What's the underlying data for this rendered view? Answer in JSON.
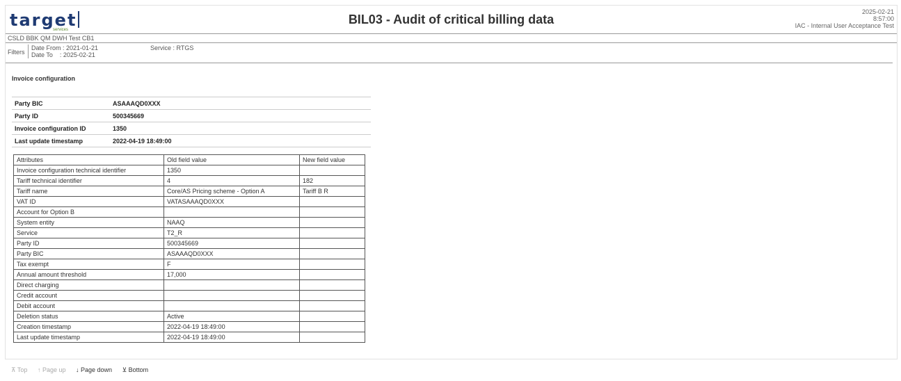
{
  "header": {
    "logo_text": "target",
    "logo_sub": "services",
    "title": "BIL03 - Audit of critical billing data",
    "date": "2025-02-21",
    "time": "8:57:00",
    "environment_name": "IAC - Internal User Acceptance Test"
  },
  "env_line": "CSLD BBK QM DWH Test CB1",
  "filters": {
    "label": "Filters",
    "date_from": "Date From : 2021-01-21",
    "date_to": "Date To    : 2025-02-21",
    "service": "Service : RTGS"
  },
  "section_title": "Invoice configuration",
  "summary": [
    {
      "key": "Party BIC",
      "value": "ASAAAQD0XXX"
    },
    {
      "key": "Party ID",
      "value": "500345669"
    },
    {
      "key": "Invoice configuration ID",
      "value": "1350"
    },
    {
      "key": "Last update timestamp",
      "value": "2022-04-19 18:49:00"
    }
  ],
  "audit_table": {
    "headers": [
      "Attributes",
      "Old field value",
      "New field value"
    ],
    "rows": [
      [
        "Invoice configuration technical identifier",
        "1350",
        ""
      ],
      [
        "Tariff technical identifier",
        "4",
        "182"
      ],
      [
        "Tariff name",
        "Core/AS Pricing scheme - Option A",
        "Tariff B R"
      ],
      [
        "VAT ID",
        "VATASAAAQD0XXX",
        ""
      ],
      [
        "Account for Option B",
        "",
        ""
      ],
      [
        "System entity",
        "NAAQ",
        ""
      ],
      [
        "Service",
        "T2_R",
        ""
      ],
      [
        "Party ID",
        "500345669",
        ""
      ],
      [
        "Party BIC",
        "ASAAAQD0XXX",
        ""
      ],
      [
        "Tax exempt",
        "F",
        ""
      ],
      [
        "Annual amount threshold",
        "17,000",
        ""
      ],
      [
        "Direct charging",
        "",
        ""
      ],
      [
        "Credit account",
        "",
        ""
      ],
      [
        "Debit account",
        "",
        ""
      ],
      [
        "Deletion status",
        "Active",
        ""
      ],
      [
        "Creation timestamp",
        "2022-04-19 18:49:00",
        ""
      ],
      [
        "Last update timestamp",
        "2022-04-19 18:49:00",
        ""
      ]
    ]
  },
  "pager": {
    "top": "⊼ Top",
    "page_up": "↑ Page up",
    "page_down": "↓ Page down",
    "bottom": "⊻ Bottom"
  }
}
